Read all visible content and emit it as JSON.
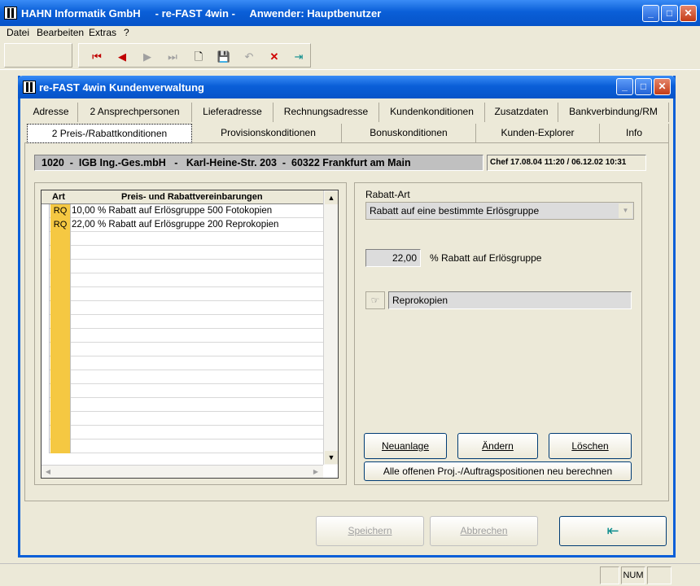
{
  "app": {
    "title": "HAHN Informatik GmbH     - re-FAST 4win -     Anwender: Hauptbenutzer",
    "menu": [
      "Datei",
      "Bearbeiten",
      "Extras",
      "?"
    ]
  },
  "dialog": {
    "title": "re-FAST 4win Kundenverwaltung",
    "tabs_row1": [
      "Adresse",
      "2 Ansprechpersonen",
      "Lieferadresse",
      "Rechnungsadresse",
      "Kundenkonditionen",
      "Zusatzdaten",
      "Bankverbindung/RM"
    ],
    "tabs_row2": [
      "2 Preis-/Rabattkonditionen",
      "Provisionskonditionen",
      "Bonuskonditionen",
      "Kunden-Explorer",
      "Info"
    ],
    "customer_line": "1020  -  IGB Ing.-Ges.mbH   -   Karl-Heine-Str. 203  -  60322 Frankfurt am Main",
    "audit": "Chef 17.08.04 11:20 / 06.12.02 10:31",
    "grid": {
      "headers": [
        "Art",
        "Preis- und Rabattvereinbarungen"
      ],
      "rows": [
        {
          "art": "RQ",
          "text": "10,00 % Rabatt auf Erlösgruppe 500 Fotokopien"
        },
        {
          "art": "RQ",
          "text": "22,00 % Rabatt auf Erlösgruppe 200 Reprokopien"
        }
      ]
    },
    "rabatt_art_label": "Rabatt-Art",
    "rabatt_art_value": "Rabatt auf eine bestimmte Erlösgruppe",
    "percent_value": "22,00",
    "percent_label": "% Rabatt auf Erlösgruppe",
    "group_value": "Reprokopien",
    "buttons": {
      "neuanlage": "Neuanlage",
      "aendern": "Ändern",
      "loeschen": "Löschen",
      "recalc": "Alle offenen Proj.-/Auftragspositionen neu berechnen",
      "speichern": "Speichern",
      "abbrechen": "Abbrechen"
    }
  },
  "status": {
    "num": "NUM"
  },
  "colors": {
    "title_blue": "#0a5fd8",
    "art_cell": "#f5c842",
    "face": "#ece9d8"
  }
}
